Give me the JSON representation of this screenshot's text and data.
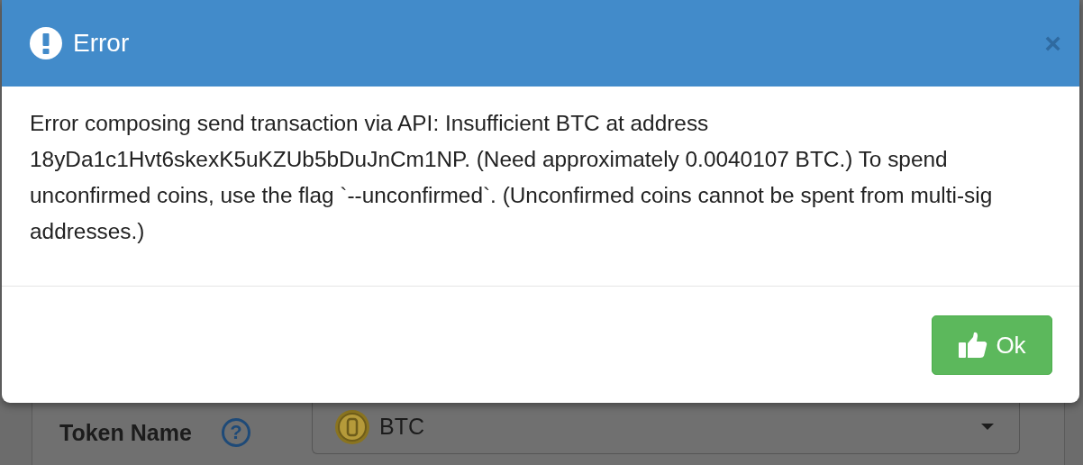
{
  "dialog": {
    "title": "Error",
    "close": "×",
    "message": "Error composing send transaction via API: Insufficient BTC at address 18yDa1c1Hvt6skexK5uKZUb5bDuJnCm1NP. (Need approximately 0.0040107 BTC.) To spend unconfirmed coins, use the flag `--unconfirmed`. (Unconfirmed coins cannot be spent from multi-sig addresses.)",
    "button": "Ok"
  },
  "form": {
    "label": "Token Name",
    "help": "?",
    "select": {
      "value": "BTC"
    }
  }
}
